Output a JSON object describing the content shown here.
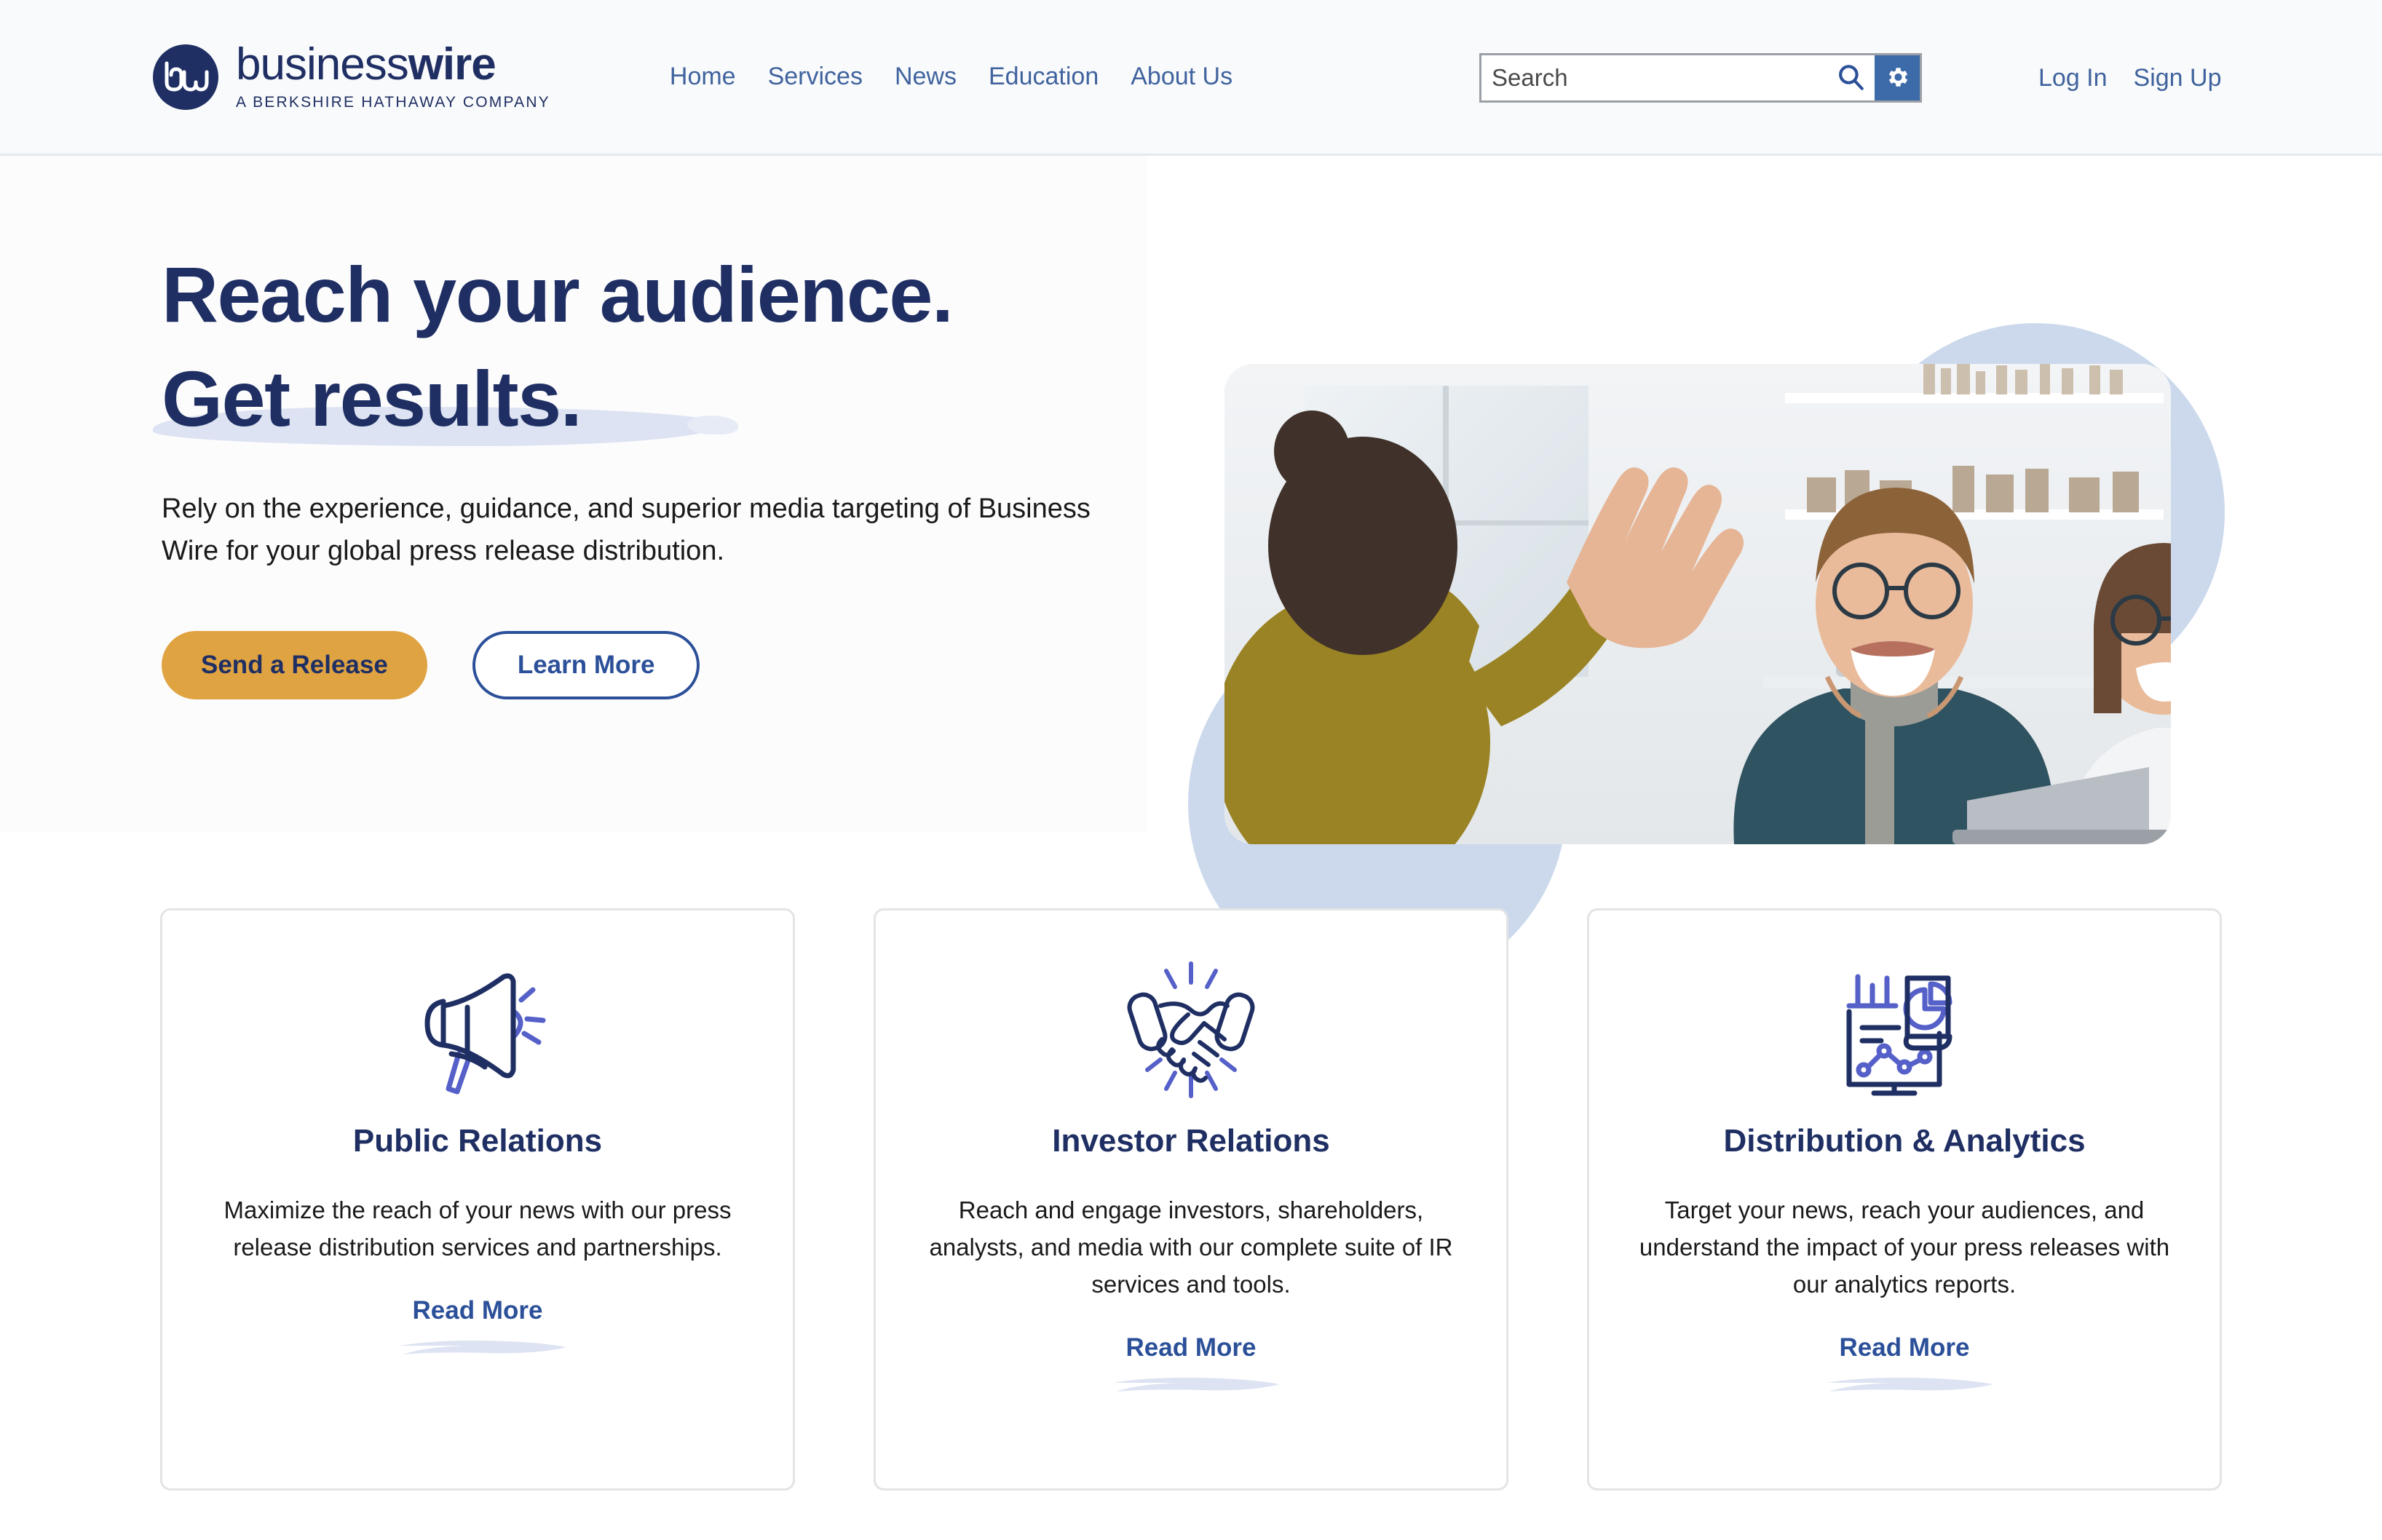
{
  "header": {
    "logo": {
      "mark_icon": "bw-monogram-icon",
      "word_light": "business",
      "word_bold": "wire",
      "tagline": "A BERKSHIRE HATHAWAY COMPANY"
    },
    "nav": [
      {
        "label": "Home"
      },
      {
        "label": "Services"
      },
      {
        "label": "News"
      },
      {
        "label": "Education"
      },
      {
        "label": "About Us"
      }
    ],
    "search": {
      "placeholder": "Search",
      "value": "",
      "search_icon": "magnifier-icon",
      "settings_icon": "gear-icon"
    },
    "auth": {
      "login": "Log In",
      "signup": "Sign Up"
    }
  },
  "hero": {
    "headline_line1": "Reach your audience.",
    "headline_line2": "Get results.",
    "subtext": "Rely on the experience, guidance, and superior media targeting of Business Wire for your global press release distribution.",
    "primary_button": "Send a Release",
    "secondary_button": "Learn More",
    "image_alt": "Colleagues high-fiving in a bright modern office"
  },
  "cards": [
    {
      "icon": "megaphone-icon",
      "title": "Public Relations",
      "body": "Maximize the reach of your news with our press release distribution services and partnerships.",
      "link": "Read More"
    },
    {
      "icon": "handshake-icon",
      "title": "Investor Relations",
      "body": "Reach and engage investors, shareholders, analysts, and media with our complete suite of IR services and tools.",
      "link": "Read More"
    },
    {
      "icon": "analytics-dashboard-icon",
      "title": "Distribution & Analytics",
      "body": "Target your news, reach your audiences, and understand the impact of your press releases with our analytics reports.",
      "link": "Read More"
    }
  ],
  "colors": {
    "navy": "#1f2f63",
    "link_blue": "#2b5099",
    "nav_blue": "#40639e",
    "gold": "#e0a342",
    "accent_periwinkle": "#5560c8",
    "pale_blue": "#ccd9ec",
    "highlight": "#dde3f2",
    "header_bg": "#f9fafb",
    "card_border": "#e4e4e6"
  }
}
